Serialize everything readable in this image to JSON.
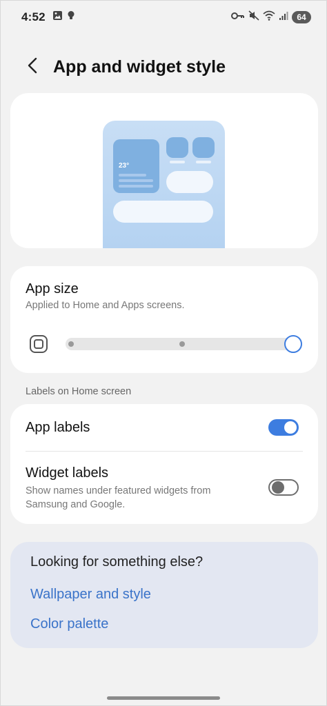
{
  "status_bar": {
    "time": "4:52",
    "battery": "64",
    "icons_left": [
      "gallery-icon",
      "bulb-icon"
    ],
    "icons_right": [
      "key-icon",
      "mute-icon",
      "wifi-icon",
      "signal-icon"
    ]
  },
  "header": {
    "title": "App and widget style",
    "back_icon": "back-arrow-icon"
  },
  "preview": {
    "weather_temp": "23°"
  },
  "app_size": {
    "title": "App size",
    "subtitle": "Applied to Home and Apps screens.",
    "slider_steps": 3,
    "slider_value_index": 2,
    "accent": "#3d7de0"
  },
  "labels_section": {
    "heading": "Labels on Home screen",
    "app_labels": {
      "title": "App labels",
      "enabled": true
    },
    "widget_labels": {
      "title": "Widget labels",
      "subtitle": "Show names under featured widgets from Samsung and Google.",
      "enabled": false
    }
  },
  "suggestions": {
    "title": "Looking for something else?",
    "links": [
      "Wallpaper and style",
      "Color palette"
    ],
    "link_color": "#3a73c9"
  }
}
